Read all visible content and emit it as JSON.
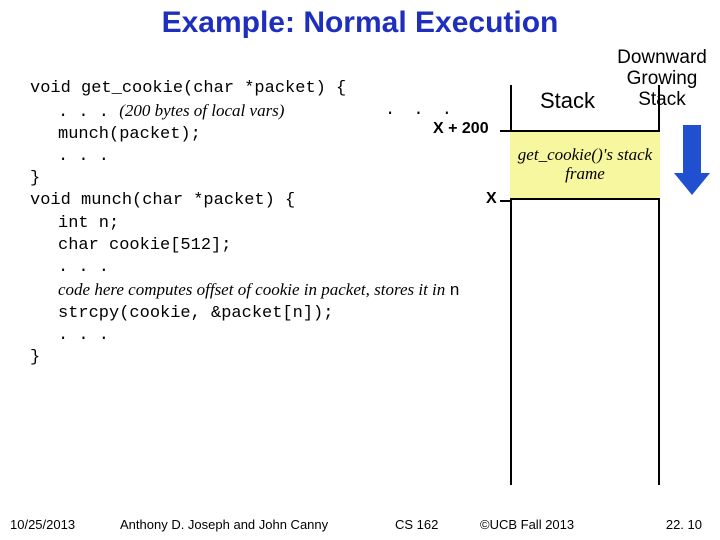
{
  "title": "Example: Normal Execution",
  "dg_heading": "Downward Growing Stack",
  "stack_label": "Stack",
  "frame_label": "get_cookie()'s stack frame",
  "pointers": {
    "xplus200": "X + 200",
    "x": "X"
  },
  "code": {
    "l1": "void get_cookie(char *packet) {",
    "l2a": ". . . ",
    "l2b": "(200 bytes of local vars)",
    "l2c": ". . .",
    "l3": "munch(packet);",
    "l4": ". . .",
    "l5": "}",
    "l6": "void munch(char *packet) {",
    "l7": "int n;",
    "l8": "char cookie[512];",
    "l9": ". . .",
    "l10": "code here computes offset of cookie in packet, stores it in ",
    "l10b": "n",
    "l11": "strcpy(cookie, &packet[n]);",
    "l12": ". . .",
    "l13": "}"
  },
  "footer": {
    "date": "10/25/2013",
    "authors": "Anthony D. Joseph and John Canny",
    "course": "CS 162",
    "copy": "©UCB Fall 2013",
    "pagenum": "22. 10"
  }
}
